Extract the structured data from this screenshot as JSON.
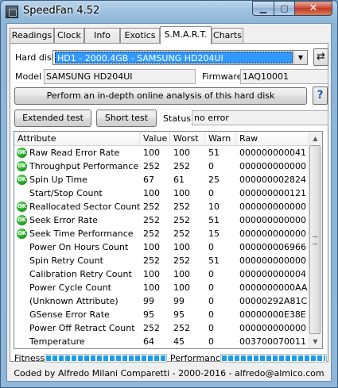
{
  "window": {
    "title": "SpeedFan 4.52",
    "minimize_glyph": "▁",
    "maximize_glyph": "▢",
    "close_glyph": "✕"
  },
  "tabs": [
    {
      "label": "Readings",
      "active": false
    },
    {
      "label": "Clock",
      "active": false
    },
    {
      "label": "Info",
      "active": false
    },
    {
      "label": "Exotics",
      "active": false
    },
    {
      "label": "S.M.A.R.T.",
      "active": true
    },
    {
      "label": "Charts",
      "active": false
    }
  ],
  "smart": {
    "hard_disk_label": "Hard disk",
    "hard_disk_value": "HD1 - 2000.4GB - SAMSUNG HD204UI",
    "model_label": "Model",
    "model_value": "SAMSUNG HD204UI",
    "firmware_label": "Firmware",
    "firmware_value": "1AQ10001",
    "analysis_button": "Perform an in-depth online analysis of this hard disk",
    "help_glyph": "?",
    "extended_test_button": "Extended test",
    "short_test_button": "Short test",
    "status_label": "Status",
    "status_value": "no error"
  },
  "table": {
    "columns": [
      "Attribute",
      "Value",
      "Worst",
      "Warn",
      "Raw"
    ],
    "ok_icon_text": "OK",
    "rows": [
      {
        "ok": true,
        "attribute": "Raw Read Error Rate",
        "value": "100",
        "worst": "100",
        "warn": "51",
        "raw": "000000000041"
      },
      {
        "ok": true,
        "attribute": "Throughput Performance",
        "value": "252",
        "worst": "252",
        "warn": "0",
        "raw": "000000000000"
      },
      {
        "ok": true,
        "attribute": "Spin Up Time",
        "value": "67",
        "worst": "61",
        "warn": "25",
        "raw": "000000002824"
      },
      {
        "ok": false,
        "attribute": "Start/Stop Count",
        "value": "100",
        "worst": "100",
        "warn": "0",
        "raw": "000000000121"
      },
      {
        "ok": true,
        "attribute": "Reallocated Sector Count",
        "value": "252",
        "worst": "252",
        "warn": "10",
        "raw": "000000000000"
      },
      {
        "ok": true,
        "attribute": "Seek Error Rate",
        "value": "252",
        "worst": "252",
        "warn": "51",
        "raw": "000000000000"
      },
      {
        "ok": true,
        "attribute": "Seek Time Performance",
        "value": "252",
        "worst": "252",
        "warn": "15",
        "raw": "000000000000"
      },
      {
        "ok": false,
        "attribute": "Power On Hours Count",
        "value": "100",
        "worst": "100",
        "warn": "0",
        "raw": "000000006966"
      },
      {
        "ok": false,
        "attribute": "Spin Retry Count",
        "value": "252",
        "worst": "252",
        "warn": "51",
        "raw": "000000000000"
      },
      {
        "ok": false,
        "attribute": "Calibration Retry Count",
        "value": "100",
        "worst": "100",
        "warn": "0",
        "raw": "000000000004"
      },
      {
        "ok": false,
        "attribute": "Power Cycle Count",
        "value": "100",
        "worst": "100",
        "warn": "0",
        "raw": "0000000000AA"
      },
      {
        "ok": false,
        "attribute": "(Unknown Attribute)",
        "value": "99",
        "worst": "99",
        "warn": "0",
        "raw": "00000292A81C"
      },
      {
        "ok": false,
        "attribute": "GSense Error Rate",
        "value": "95",
        "worst": "95",
        "warn": "0",
        "raw": "00000000E38E"
      },
      {
        "ok": false,
        "attribute": "Power Off Retract Count",
        "value": "252",
        "worst": "252",
        "warn": "0",
        "raw": "000000000000"
      },
      {
        "ok": false,
        "attribute": "Temperature",
        "value": "64",
        "worst": "45",
        "warn": "0",
        "raw": "003700070011"
      }
    ]
  },
  "gauges": {
    "fitness_label": "Fitness",
    "fitness_level": 1.0,
    "performance_label": "Performance",
    "performance_level": 1.0
  },
  "footer": {
    "credits": "Coded by Alfredo Milani Comparetti - 2000-2016 - alfredo@almico.com"
  },
  "colors": {
    "selection_blue": "#3399ff",
    "ok_green": "#129812",
    "gauge_blue": "#1f9ee8"
  }
}
